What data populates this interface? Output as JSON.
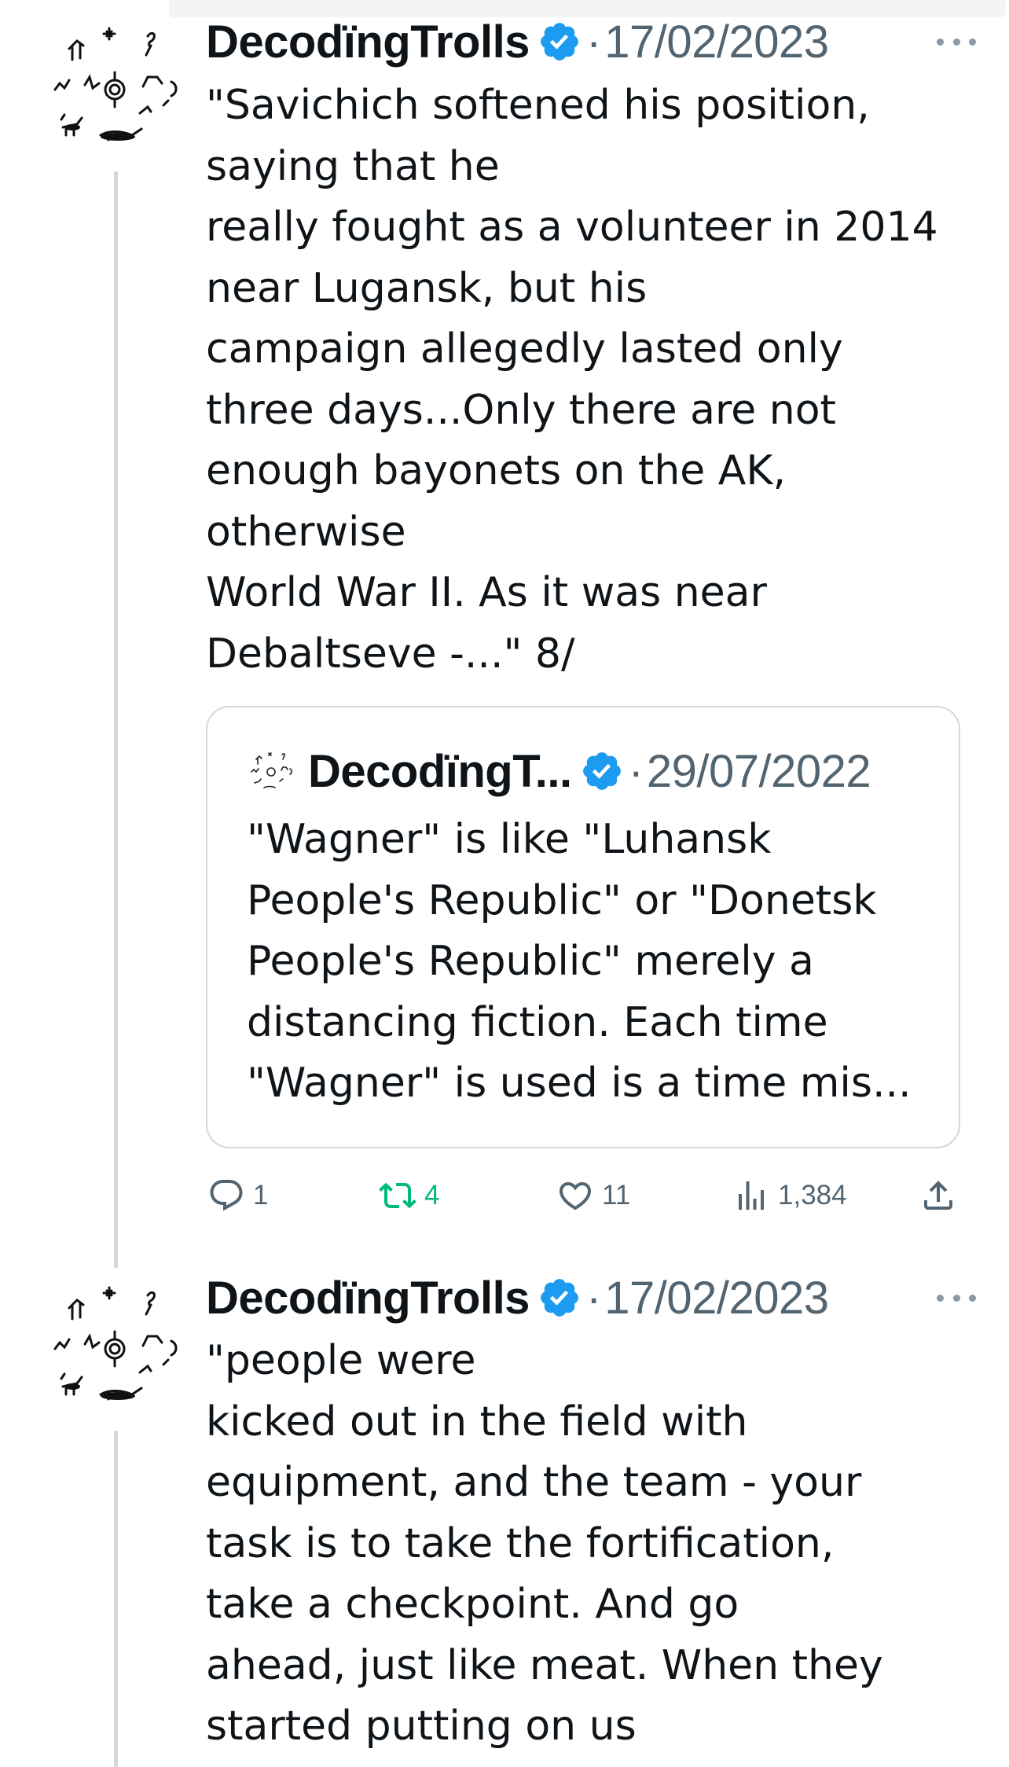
{
  "colors": {
    "verified": "#1d9bf0",
    "secondary_text": "#536471",
    "retweet_active": "#00ba7c",
    "divider": "#cfd9de"
  },
  "tweets": [
    {
      "author": "DecodïngTrolls",
      "separator": "·",
      "date": "17/02/2023",
      "body_lines": [
        "\"Savichich softened his position,",
        "saying that he",
        "really fought as a volunteer in 2014",
        "near Lugansk, but his",
        "campaign allegedly lasted only",
        "three days...Only there are not",
        "enough bayonets on the AK,",
        "otherwise",
        "World War II. As it was near",
        "Debaltseve -...\" 8/"
      ],
      "quote": {
        "author": "DecodïngT...",
        "separator": "·",
        "date": "29/07/2022",
        "body_lines": [
          "\"Wagner\" is like \"Luhansk",
          "People's Republic\" or \"Donetsk",
          "People's Republic\" merely a",
          "distancing fiction. Each time",
          "\"Wagner\" is used is a time mis..."
        ]
      },
      "actions": {
        "reply_icon": "reply-icon",
        "reply_count": "1",
        "retweet_icon": "retweet-icon",
        "retweet_count": "4",
        "like_icon": "heart-icon",
        "like_count": "11",
        "views_icon": "views-icon",
        "views_count": "1,384",
        "share_icon": "share-icon"
      }
    },
    {
      "author": "DecodïngTrolls",
      "separator": "·",
      "date": "17/02/2023",
      "body_lines": [
        "\"people were",
        "kicked out in the field with",
        "equipment, and the team - your",
        "task is to take the fortification,",
        "take a checkpoint. And go",
        "ahead, just like meat. When they",
        "started putting on us"
      ]
    }
  ]
}
